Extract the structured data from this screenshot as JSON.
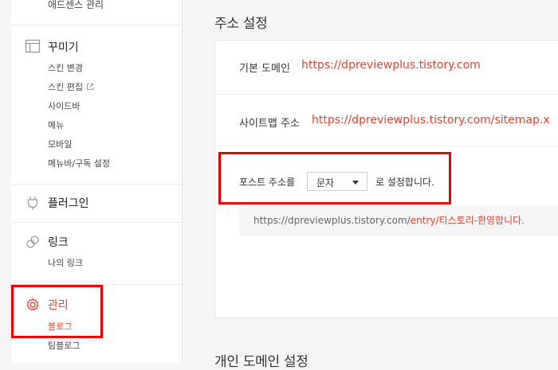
{
  "sidebar": {
    "top_item": "애드센스 관리",
    "sections": [
      {
        "title": "꾸미기",
        "icon": "layout-icon",
        "items": [
          "스킨 변경",
          "스킨 편집",
          "사이드바",
          "메뉴",
          "모바일",
          "메뉴바/구독 설정"
        ]
      },
      {
        "title": "플러그인",
        "icon": "plug-icon",
        "items": []
      },
      {
        "title": "링크",
        "icon": "link-icon",
        "items": [
          "나의 링크"
        ]
      },
      {
        "title": "관리",
        "icon": "gear-icon",
        "items": [
          "블로그",
          "팀블로그"
        ]
      }
    ]
  },
  "main": {
    "section_title": "주소 설정",
    "next_section_title": "개인 도메인 설정",
    "default_domain_label": "기본 도메인",
    "default_domain_value": "https://dpreviewplus.tistory.com",
    "sitemap_label": "사이트맵 주소",
    "sitemap_value": "https://dpreviewplus.tistory.com/sitemap.x",
    "post_address_prefix": "포스트 주소를",
    "post_address_suffix": "로 설정합니다.",
    "post_address_selected": "문자",
    "example_base": "https://dpreviewplus.tistory.com/",
    "example_highlight": "entry/티스토리-환영합니다."
  },
  "colors": {
    "accent": "#e8432f",
    "highlight_box": "#ee0000"
  }
}
